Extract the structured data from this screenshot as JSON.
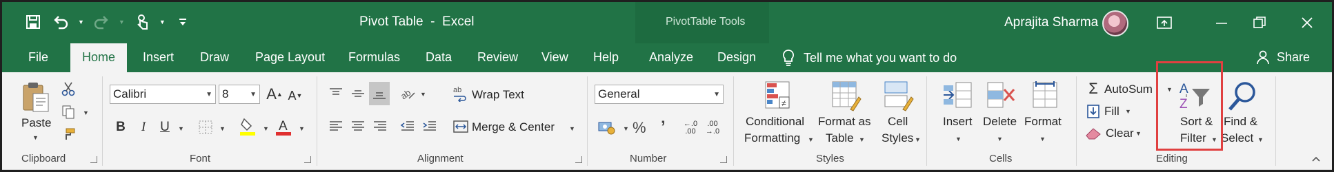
{
  "window": {
    "title": "Pivot Table  -  Excel",
    "context_tools": "PivotTable Tools",
    "user_name": "Aprajita Sharma"
  },
  "tabs": [
    {
      "label": "File"
    },
    {
      "label": "Home"
    },
    {
      "label": "Insert"
    },
    {
      "label": "Draw"
    },
    {
      "label": "Page Layout"
    },
    {
      "label": "Formulas"
    },
    {
      "label": "Data"
    },
    {
      "label": "Review"
    },
    {
      "label": "View"
    },
    {
      "label": "Help"
    },
    {
      "label": "Analyze"
    },
    {
      "label": "Design"
    }
  ],
  "tell_me": "Tell me what you want to do",
  "share_label": "Share",
  "clipboard": {
    "paste": "Paste",
    "group": "Clipboard"
  },
  "font": {
    "name": "Calibri",
    "size": "8",
    "group": "Font"
  },
  "alignment": {
    "wrap_text": "Wrap Text",
    "merge_center": "Merge & Center",
    "group": "Alignment"
  },
  "number": {
    "format": "General",
    "percent": "%",
    "comma": "’",
    "inc_decimal": ".0\n.00",
    "dec_decimal": ".00\n.0",
    "group": "Number"
  },
  "styles": {
    "conditional_1": "Conditional",
    "conditional_2": "Formatting",
    "format_table_1": "Format as",
    "format_table_2": "Table",
    "cell_styles_1": "Cell",
    "cell_styles_2": "Styles",
    "group": "Styles"
  },
  "cells": {
    "insert": "Insert",
    "delete": "Delete",
    "format": "Format",
    "group": "Cells"
  },
  "editing": {
    "autosum": "AutoSum",
    "fill": "Fill",
    "clear": "Clear",
    "sort_1": "Sort &",
    "sort_2": "Filter",
    "find_1": "Find &",
    "find_2": "Select",
    "group": "Editing"
  },
  "colors": {
    "excel_green": "#217346",
    "highlight_box": "#e04040",
    "font_color_red": "#e03030",
    "highlight_yellow": "#ffff00"
  }
}
